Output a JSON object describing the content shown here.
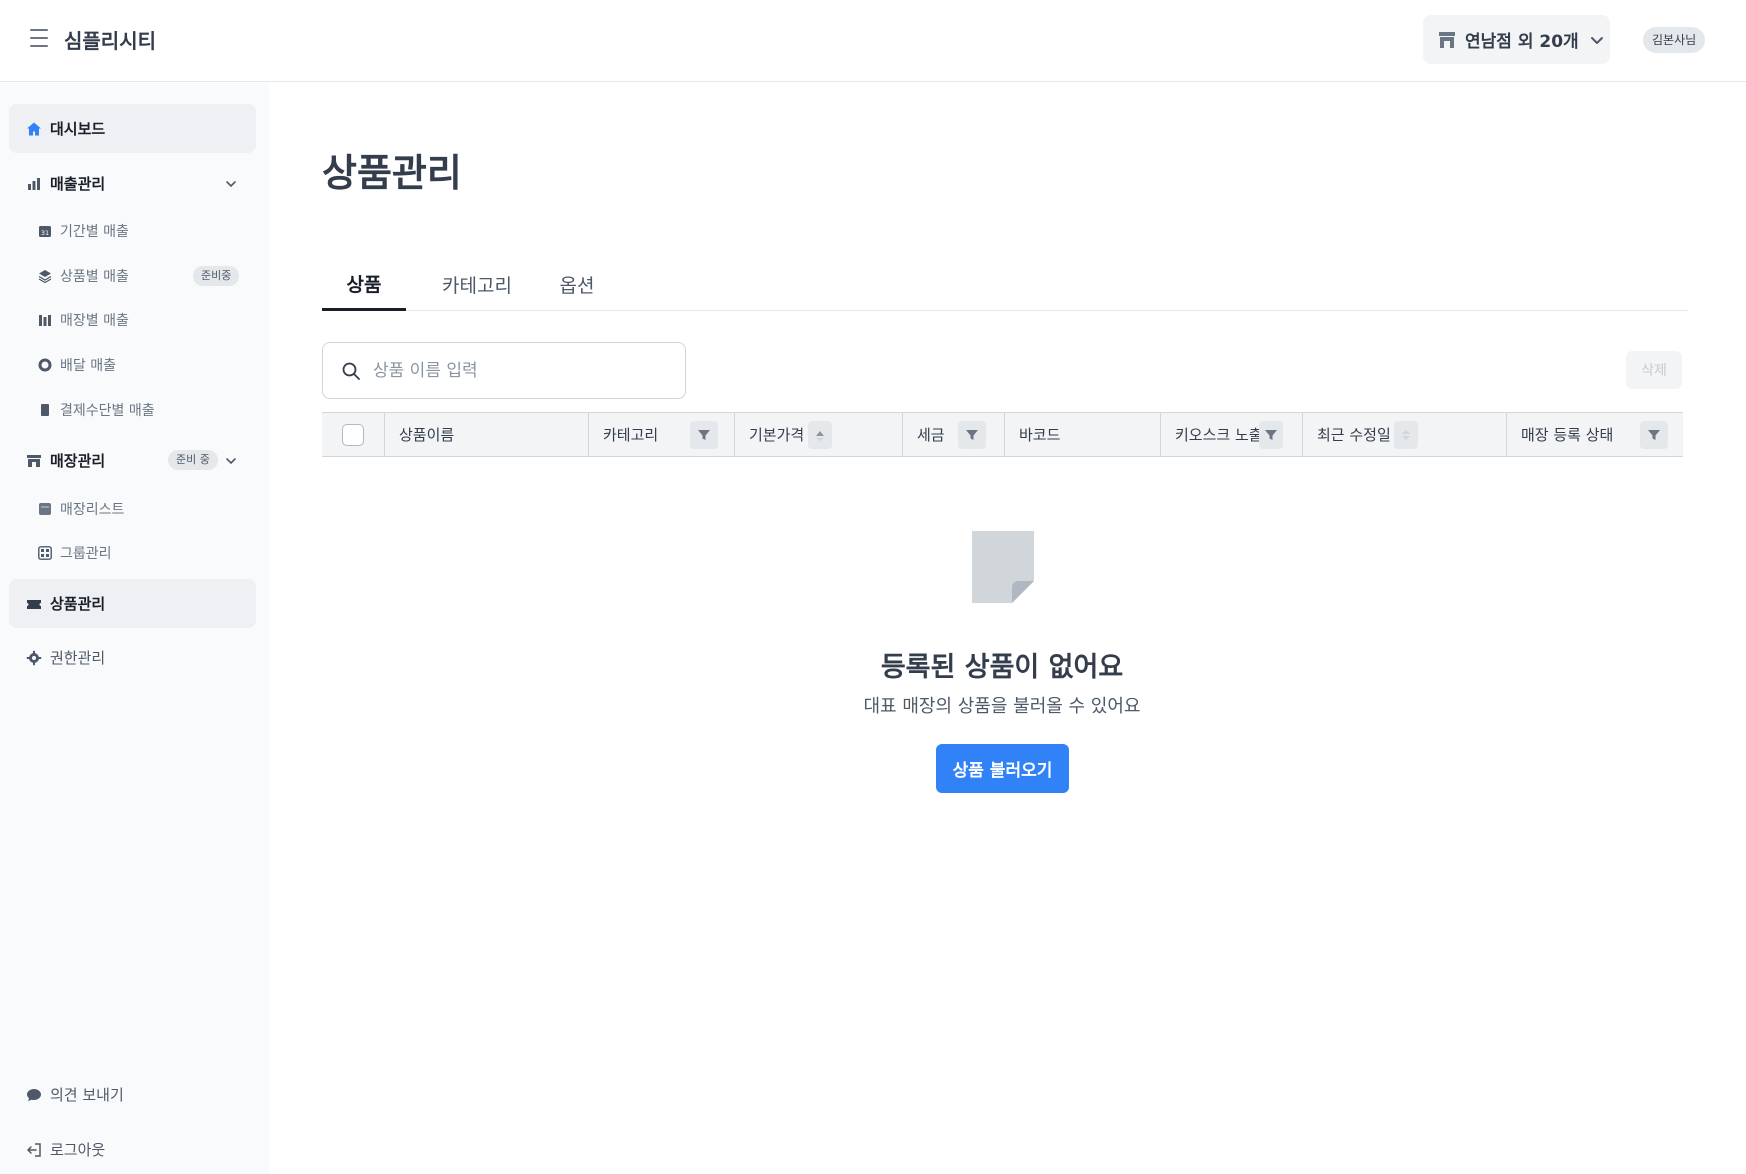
{
  "header": {
    "app_title": "심플리시티",
    "store_select_label": "연남점 외 20개",
    "user_name": "김본사님"
  },
  "sidebar": {
    "dashboard": "대시보드",
    "sales": {
      "label": "매출관리",
      "items": [
        {
          "label": "기간별 매출"
        },
        {
          "label": "상품별 매출",
          "badge": "준비중"
        },
        {
          "label": "매장별 매출"
        },
        {
          "label": "배달 매출"
        },
        {
          "label": "결제수단별 매출"
        }
      ]
    },
    "stores": {
      "label": "매장관리",
      "badge": "준비 중",
      "items": [
        {
          "label": "매장리스트"
        },
        {
          "label": "그룹관리"
        }
      ]
    },
    "products": "상품관리",
    "permissions": "권한관리",
    "feedback": "의견 보내기",
    "logout": "로그아웃"
  },
  "main": {
    "page_title": "상품관리",
    "tabs": [
      {
        "label": "상품",
        "active": true
      },
      {
        "label": "카테고리",
        "active": false
      },
      {
        "label": "옵션",
        "active": false
      }
    ],
    "search_placeholder": "상품 이름 입력",
    "delete_label": "삭제",
    "columns": [
      {
        "label": "상품이름"
      },
      {
        "label": "카테고리",
        "control": "filter"
      },
      {
        "label": "기본가격",
        "control": "sort-asc"
      },
      {
        "label": "세금",
        "control": "filter"
      },
      {
        "label": "바코드"
      },
      {
        "label": "키오스크 노출",
        "control": "filter"
      },
      {
        "label": "최근 수정일",
        "control": "sort"
      },
      {
        "label": "매장 등록 상태",
        "control": "filter"
      }
    ],
    "empty": {
      "title": "등록된 상품이 없어요",
      "description": "대표 매장의 상품을 불러올 수 있어요",
      "button": "상품 불러오기"
    }
  },
  "colors": {
    "primary": "#3182f6",
    "sidebar_bg": "#f9fafb",
    "active_item_bg": "#eef0f3",
    "text_dark": "#333d4b"
  }
}
